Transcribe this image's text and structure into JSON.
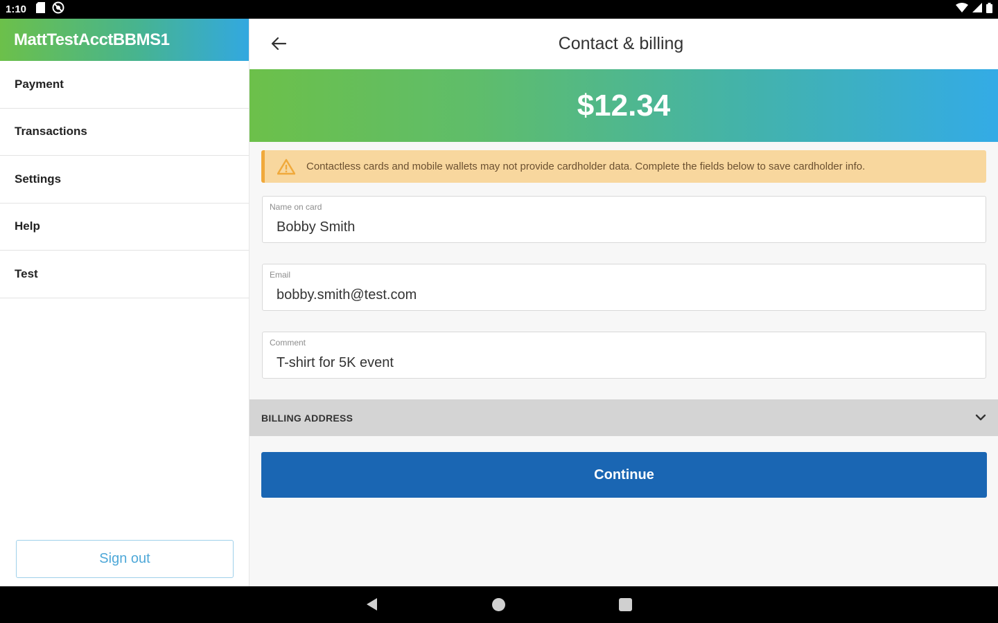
{
  "status_bar": {
    "time": "1:10",
    "icons_left": [
      "sd-card-icon",
      "no-sync-icon"
    ],
    "icons_right": [
      "wifi-icon",
      "cell-signal-icon",
      "battery-icon"
    ]
  },
  "sidebar": {
    "account_name": "MattTestAcctBBMS1",
    "items": [
      {
        "label": "Payment"
      },
      {
        "label": "Transactions"
      },
      {
        "label": "Settings"
      },
      {
        "label": "Help"
      },
      {
        "label": "Test"
      }
    ],
    "signout_label": "Sign out"
  },
  "header": {
    "title": "Contact & billing"
  },
  "amount": "$12.34",
  "alert": {
    "text": "Contactless cards and mobile wallets may not provide cardholder data. Complete the fields below to save cardholder info."
  },
  "form": {
    "name": {
      "label": "Name on card",
      "value": "Bobby Smith"
    },
    "email": {
      "label": "Email",
      "value": "bobby.smith@test.com"
    },
    "comment": {
      "label": "Comment",
      "value": "T-shirt for 5K event"
    }
  },
  "billing": {
    "label": "BILLING ADDRESS"
  },
  "continue_label": "Continue",
  "colors": {
    "brand_green": "#6cc04a",
    "brand_blue": "#33abe6",
    "primary_button": "#1a66b3",
    "alert_bg": "#f8d79e",
    "alert_border": "#f0a93b"
  }
}
